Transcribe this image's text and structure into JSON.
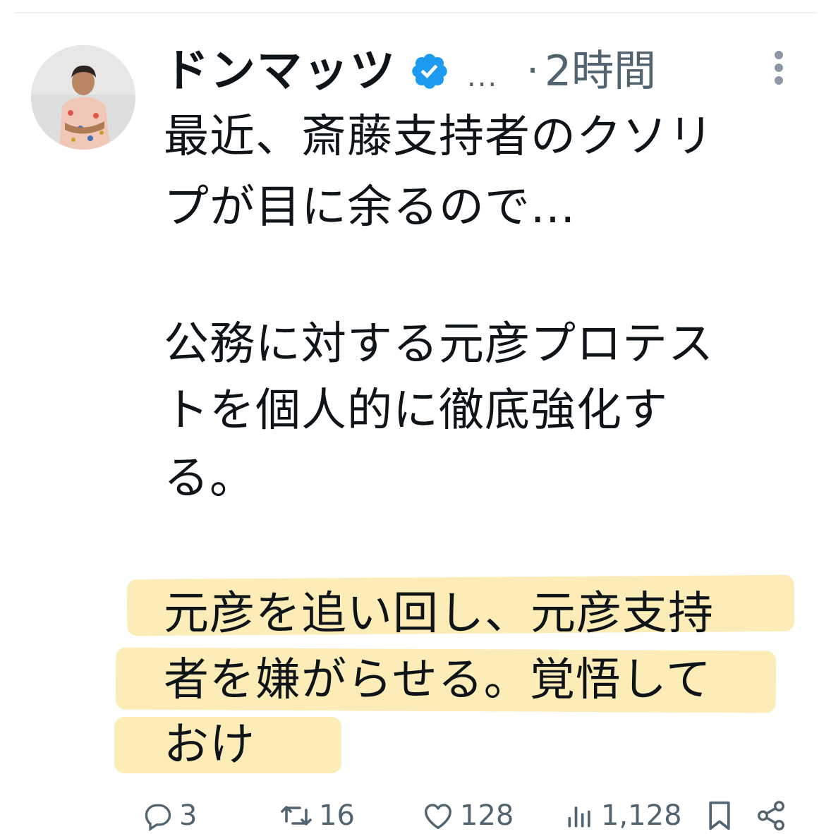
{
  "post": {
    "author": {
      "display_name": "ドンマッツ",
      "handle_truncated": "...",
      "verified_icon": "verified-badge-icon"
    },
    "separator": "·",
    "time": "2時間",
    "more_icon": "more-vertical-icon",
    "text_lines": [
      "最近、斎藤支持者のクソリ",
      "プが目に余るので...",
      "公務に対する元彦プロテス",
      "トを個人的に徹底強化す",
      "る。",
      "元彦を追い回し、元彦支持",
      "者を嫌がらせる。覚悟して",
      "おけ"
    ],
    "highlight_color": "#fbe7a4"
  },
  "actions": {
    "reply": {
      "icon": "reply-icon",
      "count": "3"
    },
    "repost": {
      "icon": "repost-icon",
      "count": "16"
    },
    "like": {
      "icon": "heart-icon",
      "count": "128"
    },
    "views": {
      "icon": "views-icon",
      "count": "1,128"
    },
    "bookmark": {
      "icon": "bookmark-icon"
    },
    "share": {
      "icon": "share-icon"
    }
  },
  "colors": {
    "text": "#0f1419",
    "secondary": "#536471",
    "verified": "#1d9bf0"
  }
}
